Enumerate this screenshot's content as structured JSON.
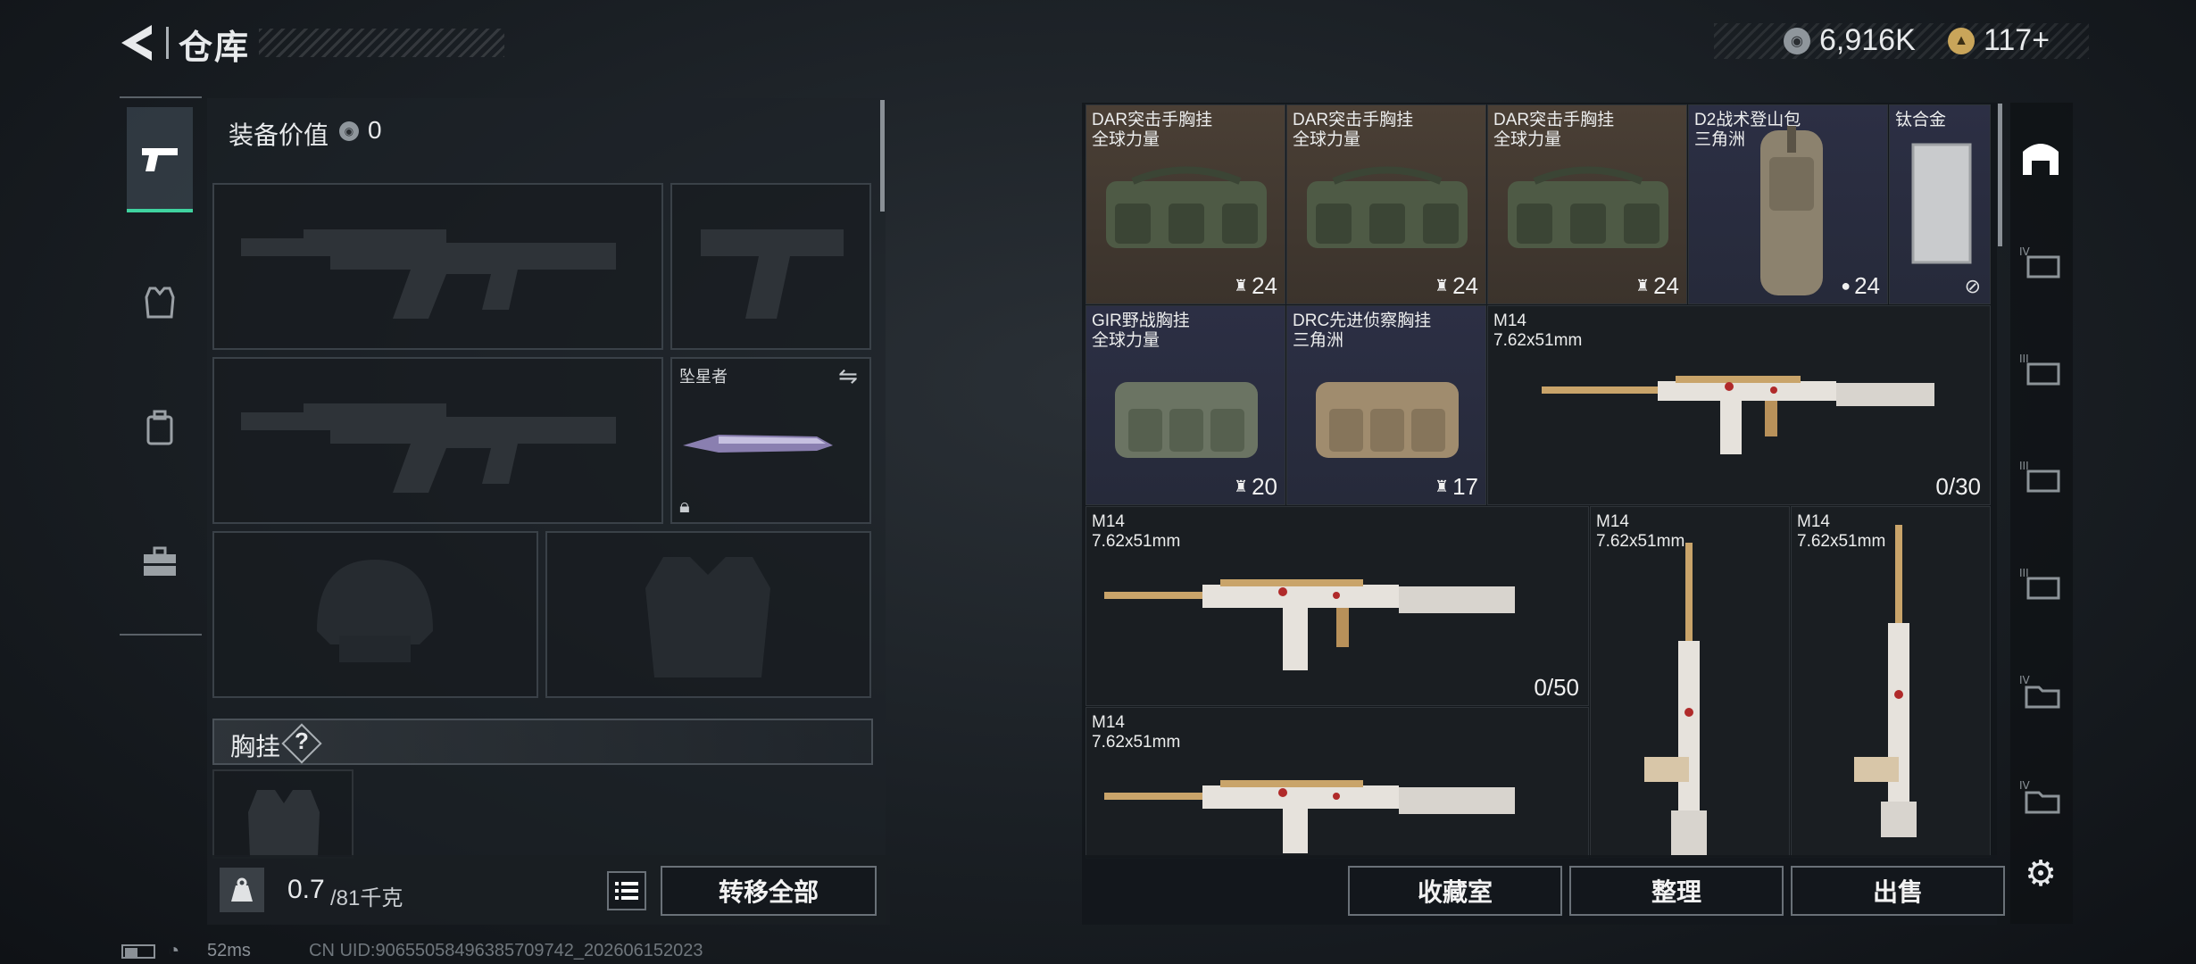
{
  "header": {
    "title": "仓库"
  },
  "currency": {
    "coins": "6,916K",
    "tokens": "117+"
  },
  "equipment": {
    "value_label": "装备价值",
    "value": "0"
  },
  "melee_slot": {
    "name": "坠星者"
  },
  "chest_rig": {
    "label": "胸挂",
    "help": "?"
  },
  "capacity": {
    "current": "0.7",
    "max": "/81千克"
  },
  "buttons": {
    "transfer_all": "转移全部",
    "collection": "收藏室",
    "sort": "整理",
    "sell": "出售"
  },
  "status": {
    "ping": "52ms",
    "uid": "CN UID:9065505849638570974​2_202606152023"
  },
  "stash_items": [
    {
      "name": "DAR突击手胸挂",
      "sub": "全球力量",
      "count": "24"
    },
    {
      "name": "DAR突击手胸挂",
      "sub": "全球力量",
      "count": "24"
    },
    {
      "name": "DAR突击手胸挂",
      "sub": "全球力量",
      "count": "24"
    },
    {
      "name": "D2战术登山包",
      "sub": "三角洲",
      "count": "24"
    },
    {
      "name": "钛合金",
      "sub": "",
      "count": ""
    },
    {
      "name": "GIR野战胸挂",
      "sub": "全球力量",
      "count": "20"
    },
    {
      "name": "DRC先进侦察胸挂",
      "sub": "三角洲",
      "count": "17"
    },
    {
      "name": "M14",
      "sub": "7.62x51mm",
      "count": "0/30"
    },
    {
      "name": "M14",
      "sub": "7.62x51mm",
      "count": "0/50"
    },
    {
      "name": "M14",
      "sub": "7.62x51mm",
      "count": ""
    },
    {
      "name": "M14",
      "sub": "7.62x51mm",
      "count": ""
    },
    {
      "name": "M14",
      "sub": "7.62x51mm",
      "count": ""
    }
  ],
  "colors": {
    "accent": "#3fd3a0",
    "brown_cell": "#4a3f35",
    "blue_cell": "#2c2f44"
  }
}
